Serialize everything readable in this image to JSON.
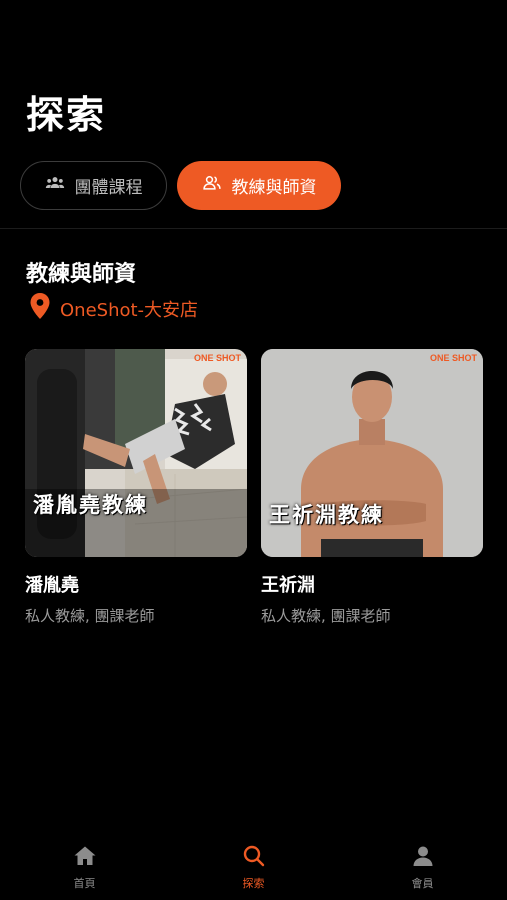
{
  "header": {
    "title": "探索"
  },
  "tabs": [
    {
      "label": "團體課程",
      "icon": "group-icon",
      "active": false
    },
    {
      "label": "教練與師資",
      "icon": "users-icon",
      "active": true
    }
  ],
  "section": {
    "title": "教練與師資",
    "location": "OneShot-大安店"
  },
  "coaches": [
    {
      "name": "潘胤堯",
      "roles": "私人教練, 團課老師",
      "photo_caption": "潘胤堯教練",
      "brand": "ONE SHOT"
    },
    {
      "name": "王祈淵",
      "roles": "私人教練, 團課老師",
      "photo_caption": "王祈淵教練",
      "brand": "ONE SHOT"
    }
  ],
  "bottom_nav": [
    {
      "label": "首頁",
      "icon": "home-icon",
      "active": false
    },
    {
      "label": "探索",
      "icon": "search-icon",
      "active": true
    },
    {
      "label": "會員",
      "icon": "person-icon",
      "active": false
    }
  ],
  "colors": {
    "accent": "#ee5a24",
    "background": "#000000"
  }
}
